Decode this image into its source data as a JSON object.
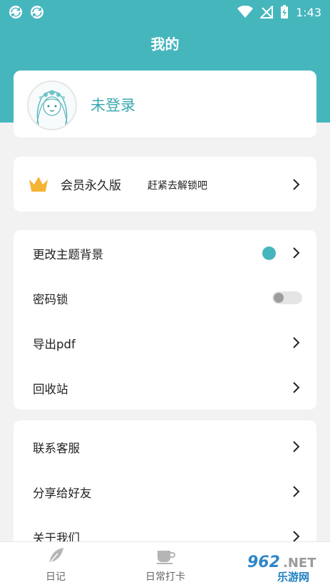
{
  "status_bar": {
    "time": "1:43"
  },
  "header": {
    "title": "我的"
  },
  "profile": {
    "name": "未登录"
  },
  "vip": {
    "label": "会员永久版",
    "subtitle": "赶紧去解锁吧"
  },
  "settings": {
    "items": [
      {
        "label": "更改主题背景"
      },
      {
        "label": "密码锁"
      },
      {
        "label": "导出pdf"
      },
      {
        "label": "回收站"
      }
    ],
    "theme_color": "#46b6bd",
    "password_lock_enabled": false
  },
  "more": {
    "items": [
      {
        "label": "联系客服"
      },
      {
        "label": "分享给好友"
      },
      {
        "label": "关于我们"
      }
    ]
  },
  "tabs": [
    {
      "label": "日记",
      "icon": "feather-icon"
    },
    {
      "label": "日常打卡",
      "icon": "cup-icon"
    }
  ],
  "watermark": {
    "text": "962.NET",
    "subtext": "乐游网"
  }
}
